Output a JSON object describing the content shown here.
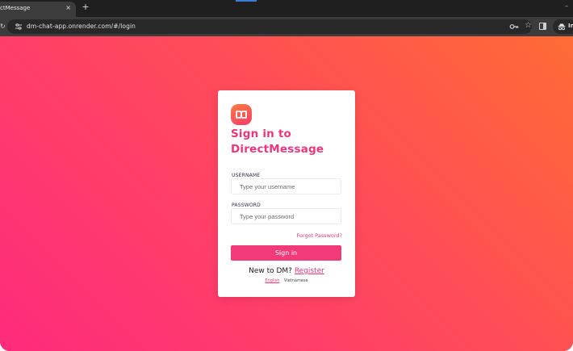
{
  "browser": {
    "tab_title": "ctMessage",
    "tab_close": "×",
    "new_tab": "+",
    "minimize": "–",
    "url": "dm-chat-app.onrender.com/#/login",
    "incognito_label": "In"
  },
  "icons": {
    "site_info": "tune-icon",
    "password_manager": "key-icon",
    "bookmark": "star-icon",
    "side_panel": "side-panel-icon",
    "incognito": "incognito-icon",
    "app_logo": "infinity-logo-icon"
  },
  "colors": {
    "accent": "#f0357a",
    "button": "#f23a7b",
    "gradient_start": "#ff6b35",
    "gradient_end": "#ff2a7c"
  },
  "login": {
    "title": "Sign in to DirectMessage",
    "username_label": "USERNAME",
    "username_placeholder": "Type your username",
    "password_label": "PASSWORD",
    "password_placeholder": "Type your password",
    "forgot": "Forgot Password?",
    "signin_button": "Sign in",
    "register_prompt": "New to DM?",
    "register_link": "Register",
    "languages": [
      "English",
      "Vietnamese"
    ]
  }
}
